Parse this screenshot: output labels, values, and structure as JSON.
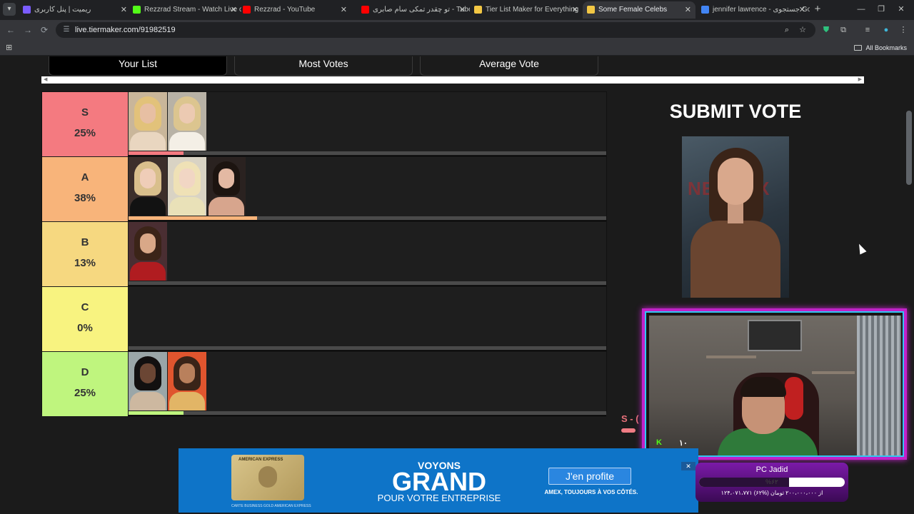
{
  "browser": {
    "tabs": [
      {
        "title": "ریمیت | پنل کاربری",
        "favicon_color": "#7a5cff"
      },
      {
        "title": "Rezzrad Stream - Watch Live on",
        "favicon_color": "#53fc18"
      },
      {
        "title": "Rezzrad - YouTube",
        "favicon_color": "#ff0000"
      },
      {
        "title": "تو چقدر تمکی سام صابری - Tube",
        "favicon_color": "#ff0000"
      },
      {
        "title": "Tier List Maker for Everything",
        "favicon_color": "#f2c744"
      },
      {
        "title": "Some Female Celebs",
        "favicon_color": "#f2c744"
      },
      {
        "title": "jennifer lawrence - جستجوی Go",
        "favicon_color": "#4285f4"
      }
    ],
    "active_tab": 5,
    "url": "live.tiermaker.com/91982519",
    "bookmarks_label": "All Bookmarks"
  },
  "page": {
    "list_tabs": [
      "Your List",
      "Most Votes",
      "Average Vote"
    ],
    "active_list_tab": 0,
    "submit_title": "SUBMIT VOTE",
    "mini_tier_label": "S - (",
    "tiers": [
      {
        "letter": "S",
        "percent": "25%",
        "color": "#f47a80",
        "fill_percent": 11.5,
        "fill_color": "#f47a80",
        "items": [
          {
            "bg": "#c9b69a",
            "hair": "#e2c27a",
            "skin": "#e7bfa3",
            "body": "#e9d6c0"
          },
          {
            "bg": "#b8b2a6",
            "hair": "#dcc58f",
            "skin": "#eccab2",
            "body": "#f4efe6"
          }
        ]
      },
      {
        "letter": "A",
        "percent": "38%",
        "color": "#f8b47a",
        "fill_percent": 26.9,
        "fill_color": "#f8b47a",
        "items": [
          {
            "bg": "#3d2f2b",
            "hair": "#d9bf8c",
            "skin": "#efcdb8",
            "body": "#121212"
          },
          {
            "bg": "#d9d3c4",
            "hair": "#efe1b6",
            "skin": "#f1d6c4",
            "body": "#e9e1b8"
          },
          {
            "bg": "#2a2220",
            "hair": "#1c1410",
            "skin": "#e3b9a3",
            "body": "#d7a58d"
          }
        ]
      },
      {
        "letter": "B",
        "percent": "13%",
        "color": "#f6d880",
        "fill_percent": 0,
        "fill_color": "#f6d880",
        "items": [
          {
            "bg": "#4a2e32",
            "hair": "#3b2418",
            "skin": "#d9a888",
            "body": "#b01c20"
          }
        ]
      },
      {
        "letter": "C",
        "percent": "0%",
        "color": "#f8f380",
        "fill_percent": 0,
        "fill_color": "#f8f380",
        "items": []
      },
      {
        "letter": "D",
        "percent": "25%",
        "color": "#bff57e",
        "fill_percent": 11.5,
        "fill_color": "#bff57e",
        "items": [
          {
            "bg": "#9aa6a8",
            "hair": "#121010",
            "skin": "#6b4634",
            "body": "#cdb8a0"
          },
          {
            "bg": "#e0552e",
            "hair": "#3a2418",
            "skin": "#b9805c",
            "body": "#e2b566"
          }
        ]
      }
    ]
  },
  "stream_overlay": {
    "viewer_count": "١٠",
    "goal_title": "PC Jadid",
    "goal_percent_label": "%۶۲",
    "goal_fraction": 0.62,
    "goal_amount": "۱۲۴،۰۷۱،۷۷۱ از ۲۰۰،۰۰۰،۰۰۰ تومان (%۶۲)"
  },
  "ad": {
    "card_brand": "AMERICAN EXPRESS",
    "card_fine_print": "CARTE BUSINESS GOLD AMERICAN EXPRESS",
    "headline_top": "VOYONS",
    "headline_main": "GRAND",
    "headline_sub": "POUR VOTRE ENTREPRISE",
    "cta": "J'en profite",
    "tagline": "AMEX, TOUJOURS À VOS CÔTÉS."
  }
}
